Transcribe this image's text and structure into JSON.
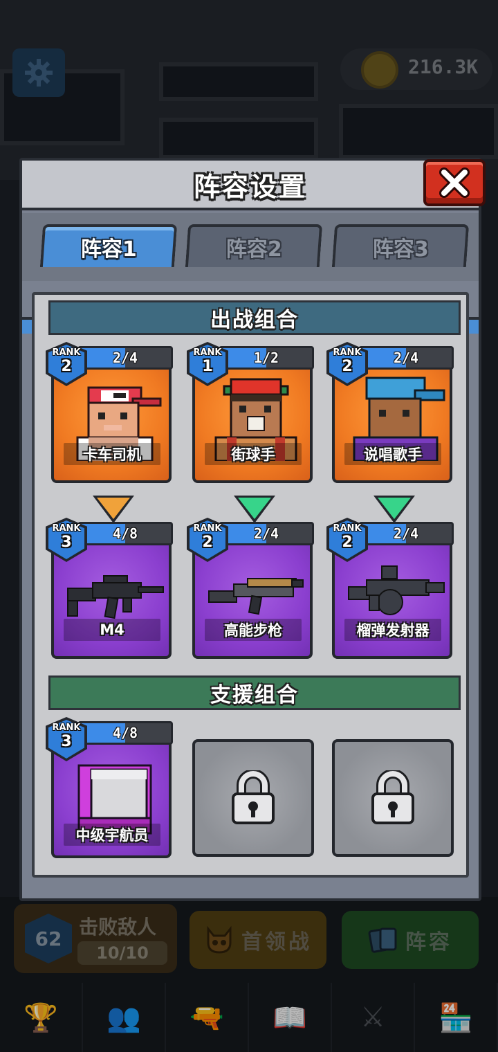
{
  "background": {
    "coins": "216.3K",
    "progress": {
      "level": "62",
      "title": "击败敌人",
      "count": "10/10"
    },
    "boss_battle_label": "首领战",
    "lineup_label": "阵容"
  },
  "modal": {
    "title": "阵容设置",
    "tabs": [
      {
        "label": "阵容1",
        "active": true
      },
      {
        "label": "阵容2",
        "active": false
      },
      {
        "label": "阵容3",
        "active": false
      }
    ],
    "battle_section_title": "出战组合",
    "support_section_title": "支援组合",
    "characters": [
      {
        "rank_label": "RANK",
        "rank": "2",
        "progress": "2/4",
        "fill": 0.5,
        "name": "卡车司机",
        "icon": "trucker-character"
      },
      {
        "rank_label": "RANK",
        "rank": "1",
        "progress": "1/2",
        "fill": 0.5,
        "name": "街球手",
        "icon": "streetballer-character"
      },
      {
        "rank_label": "RANK",
        "rank": "2",
        "progress": "2/4",
        "fill": 0.5,
        "name": "说唱歌手",
        "icon": "rapper-character"
      }
    ],
    "upgrade_arrows": [
      {
        "color": "#f0a23a"
      },
      {
        "color": "#37d48a"
      },
      {
        "color": "#37d48a"
      }
    ],
    "weapons": [
      {
        "rank_label": "RANK",
        "rank": "3",
        "progress": "4/8",
        "fill": 0.5,
        "name": "M4",
        "icon": "assault-rifle"
      },
      {
        "rank_label": "RANK",
        "rank": "2",
        "progress": "2/4",
        "fill": 0.5,
        "name": "高能步枪",
        "icon": "energy-rifle"
      },
      {
        "rank_label": "RANK",
        "rank": "2",
        "progress": "2/4",
        "fill": 0.5,
        "name": "榴弹发射器",
        "icon": "grenade-launcher"
      }
    ],
    "support": [
      {
        "rank_label": "RANK",
        "rank": "3",
        "progress": "4/8",
        "fill": 0.5,
        "name": "中级宇航员",
        "icon": "astronaut-character"
      }
    ],
    "locked_slots": 2
  }
}
